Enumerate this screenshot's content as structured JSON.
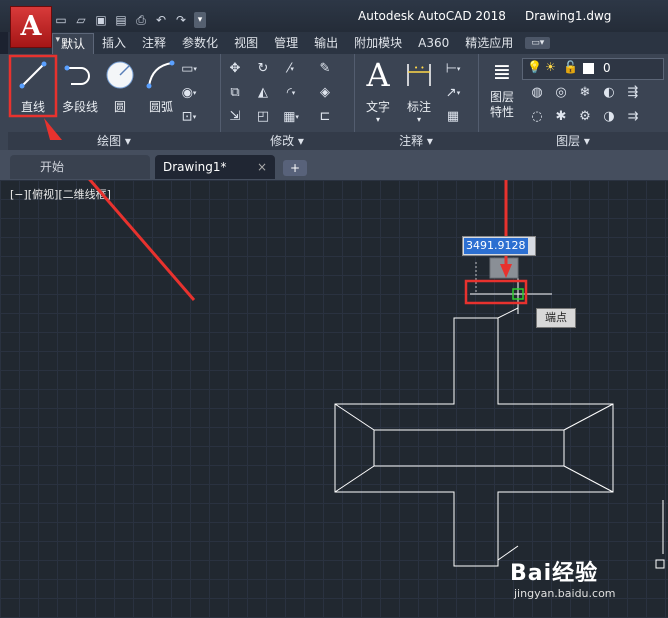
{
  "app": {
    "icon_letter": "A",
    "title": "Autodesk AutoCAD 2018",
    "file": "Drawing1.dwg"
  },
  "qat": {
    "icons": [
      "new-icon",
      "open-icon",
      "save-icon",
      "saveas-icon",
      "print-icon",
      "undo-icon",
      "redo-icon"
    ]
  },
  "ribbon_tabs": [
    "默认",
    "插入",
    "注释",
    "参数化",
    "视图",
    "管理",
    "输出",
    "附加模块",
    "A360",
    "精选应用"
  ],
  "panels": {
    "draw": {
      "title": "绘图",
      "tools": {
        "line": "直线",
        "polyline": "多段线",
        "circle": "圆",
        "arc": "圆弧"
      }
    },
    "modify": {
      "title": "修改"
    },
    "annotation": {
      "title": "注释",
      "tools": {
        "text": "文字",
        "dimension": "标注"
      }
    },
    "layers": {
      "title": "图层",
      "properties": "图层\n特性",
      "current_layer": "0"
    }
  },
  "doc_tabs": {
    "start": "开始",
    "drawing": "Drawing1*",
    "close": "×",
    "new": "+"
  },
  "viewport": {
    "label": "[−][俯视][二维线框]"
  },
  "cursor": {
    "coordinate_readout": "3491.9128",
    "snap_tooltip": "端点"
  },
  "watermark": {
    "brand": "Bai经验",
    "url": "jingyan.baidu.com"
  },
  "colors": {
    "canvas": "#212830",
    "ribbon": "#3b4453",
    "highlight_red": "#e8322e",
    "snap_green": "#2ecc2e",
    "app_red": "#c62828"
  }
}
